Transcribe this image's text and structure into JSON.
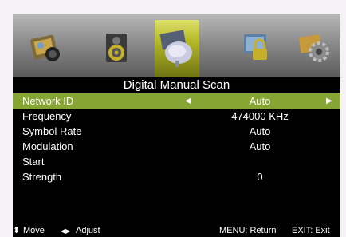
{
  "icons": [
    {
      "name": "picture-icon"
    },
    {
      "name": "sound-icon"
    },
    {
      "name": "channel-icon"
    },
    {
      "name": "lock-icon"
    },
    {
      "name": "setup-icon"
    }
  ],
  "selected_icon_index": 2,
  "title": "Digital Manual Scan",
  "rows": [
    {
      "label": "Network ID",
      "value": "Auto"
    },
    {
      "label": "Frequency",
      "value": "474000 KHz"
    },
    {
      "label": "Symbol Rate",
      "value": "Auto"
    },
    {
      "label": "Modulation",
      "value": "Auto"
    },
    {
      "label": "Start",
      "value": ""
    },
    {
      "label": "Strength",
      "value": "0"
    }
  ],
  "arrows": {
    "left": "◀",
    "right": "▶"
  },
  "footer": {
    "move_icon": "⬍",
    "move_label": "Move",
    "adjust_icon": "◀▶",
    "adjust_label": "Adjust",
    "menu_hint": "MENU: Return",
    "exit_hint": "EXIT: Exit"
  },
  "colors": {
    "highlight": "#86a532",
    "selected_tab": "#b7bb2a"
  }
}
